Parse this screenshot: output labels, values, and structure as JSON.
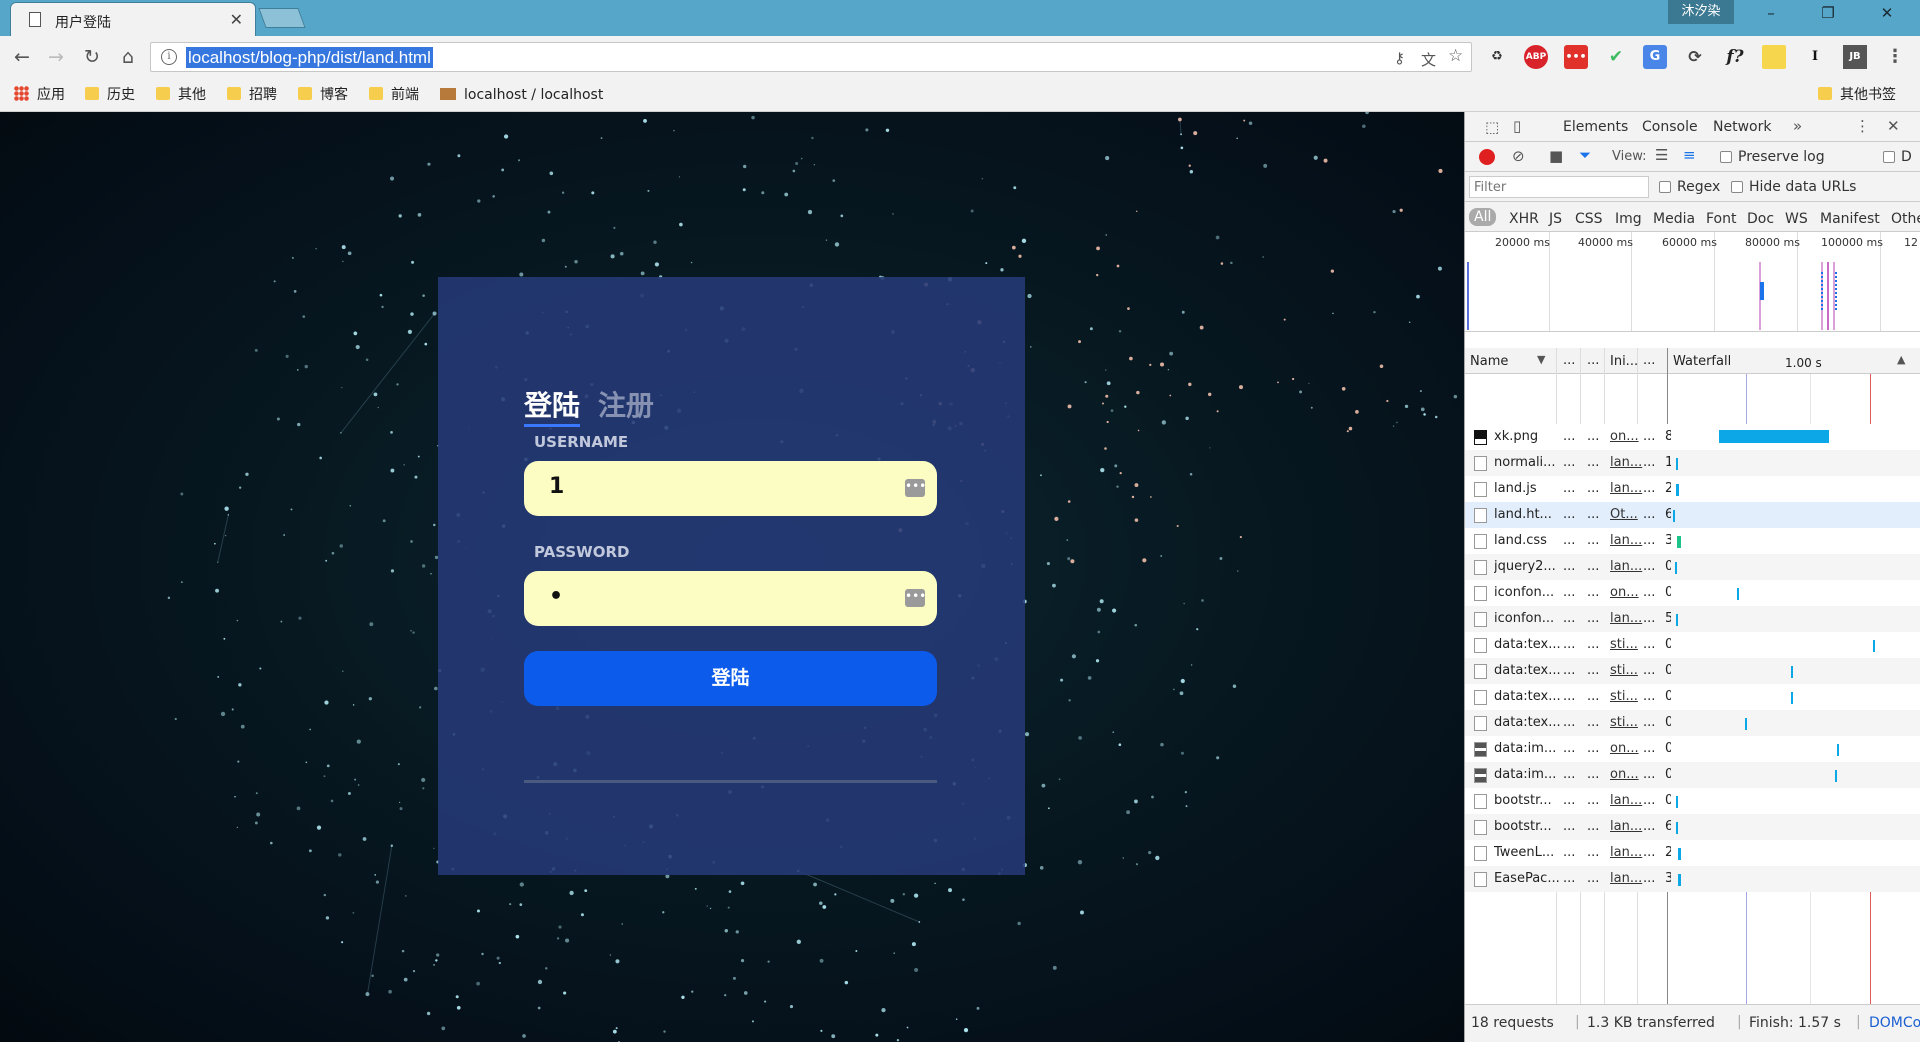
{
  "browser": {
    "tab_title": "用户登陆",
    "profile_name": "沐汐染",
    "url": "localhost/blog-php/dist/land.html"
  },
  "bookmarks": [
    {
      "label": "应用",
      "kind": "apps"
    },
    {
      "label": "历史",
      "kind": "folder"
    },
    {
      "label": "其他",
      "kind": "folder"
    },
    {
      "label": "招聘",
      "kind": "folder"
    },
    {
      "label": "博客",
      "kind": "folder"
    },
    {
      "label": "前端",
      "kind": "folder"
    },
    {
      "label": "localhost / localhost",
      "kind": "page"
    }
  ],
  "other_bookmarks": "其他书签",
  "login": {
    "tab_login": "登陆",
    "tab_register": "注册",
    "username_label": "USERNAME",
    "username_value": "1",
    "password_label": "PASSWORD",
    "password_value": "•",
    "submit_label": "登陆"
  },
  "devtools": {
    "tabs": [
      "Elements",
      "Console",
      "Network"
    ],
    "active_tab": "Network",
    "view_label": "View:",
    "preserve_log": "Preserve log",
    "disable_cache": "D",
    "filter_placeholder": "Filter",
    "regex": "Regex",
    "hide_data_urls": "Hide data URLs",
    "type_filters": [
      "All",
      "XHR",
      "JS",
      "CSS",
      "Img",
      "Media",
      "Font",
      "Doc",
      "WS",
      "Manifest",
      "Othe"
    ],
    "timeline_ticks": [
      "20000 ms",
      "40000 ms",
      "60000 ms",
      "80000 ms",
      "100000 ms",
      "12"
    ],
    "columns": {
      "name": "Name",
      "initiator": "Ini...",
      "waterfall": "Waterfall",
      "waterfall_scale": "1.00 s"
    },
    "requests": [
      {
        "name": "xk.png",
        "initiator": "on...",
        "size": "8",
        "icon": "img-black",
        "bar_color": "#0ba7e6"
      },
      {
        "name": "normali...",
        "initiator": "lan...",
        "size": "1",
        "icon": "doc",
        "bar_color": "#0ba7e6"
      },
      {
        "name": "land.js",
        "initiator": "lan...",
        "size": "2",
        "icon": "doc",
        "bar_color": "#0ba7e6"
      },
      {
        "name": "land.ht...",
        "initiator": "Ot...",
        "size": "6",
        "icon": "doc",
        "bar_color": "#0ba7e6"
      },
      {
        "name": "land.css",
        "initiator": "lan...",
        "size": "3",
        "icon": "doc",
        "bar_color": "#1dc48a"
      },
      {
        "name": "jquery2...",
        "initiator": "lan...",
        "size": "0",
        "icon": "doc",
        "bar_color": "#0ba7e6"
      },
      {
        "name": "iconfon...",
        "initiator": "on...",
        "size": "0",
        "icon": "doc",
        "bar_color": "#0ba7e6"
      },
      {
        "name": "iconfon...",
        "initiator": "lan...",
        "size": "5",
        "icon": "doc",
        "bar_color": "#0ba7e6"
      },
      {
        "name": "data:tex...",
        "initiator": "sti...",
        "size": "0",
        "icon": "doc",
        "bar_color": "#0ba7e6"
      },
      {
        "name": "data:tex...",
        "initiator": "sti...",
        "size": "0",
        "icon": "doc",
        "bar_color": "#0ba7e6"
      },
      {
        "name": "data:tex...",
        "initiator": "sti...",
        "size": "0",
        "icon": "doc",
        "bar_color": "#0ba7e6"
      },
      {
        "name": "data:tex...",
        "initiator": "sti...",
        "size": "0",
        "icon": "doc",
        "bar_color": "#0ba7e6"
      },
      {
        "name": "data:im...",
        "initiator": "on...",
        "size": "0",
        "icon": "img",
        "bar_color": "#0ba7e6"
      },
      {
        "name": "data:im...",
        "initiator": "on...",
        "size": "0",
        "icon": "img",
        "bar_color": "#0ba7e6"
      },
      {
        "name": "bootstr...",
        "initiator": "lan...",
        "size": "0",
        "icon": "doc",
        "bar_color": "#0ba7e6"
      },
      {
        "name": "bootstr...",
        "initiator": "lan...",
        "size": "6",
        "icon": "doc",
        "bar_color": "#0ba7e6"
      },
      {
        "name": "TweenL...",
        "initiator": "lan...",
        "size": "2",
        "icon": "doc",
        "bar_color": "#0ba7e6"
      },
      {
        "name": "EasePac...",
        "initiator": "lan...",
        "size": "3",
        "icon": "doc",
        "bar_color": "#0ba7e6"
      }
    ],
    "status": {
      "requests": "18 requests",
      "transferred": "1.3 KB transferred",
      "finish": "Finish: 1.57 s",
      "domcontent": "DOMContentLo..."
    }
  },
  "colors": {
    "chrome_frame": "#55a6c8",
    "card_bg": "#263a78",
    "input_bg": "#fcfdc3",
    "button_bg": "#0d5bea",
    "record": "#e02020",
    "network_tab_underline": "#1a73e8"
  }
}
